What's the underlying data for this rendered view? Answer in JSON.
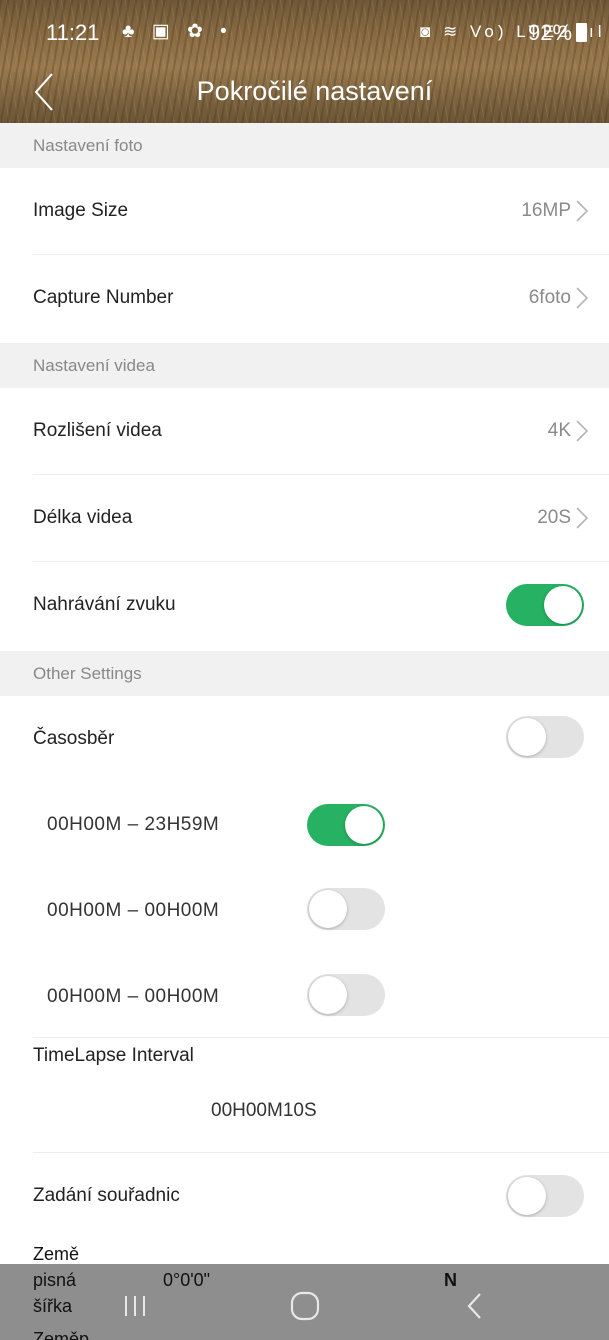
{
  "status_bar": {
    "time": "11:21",
    "left_icons": "♣ ▣ ✿ •",
    "right_icons": "◙ ≋ Vo) LTE2 .ıl",
    "battery": "92%"
  },
  "header": {
    "title": "Pokročilé nastavení"
  },
  "sections": {
    "photo": "Nastavení foto",
    "video": "Nastavení videa",
    "other": "Other Settings"
  },
  "photo": {
    "image_size_label": "Image Size",
    "image_size_value": "16MP",
    "capture_number_label": "Capture Number",
    "capture_number_value": "6foto"
  },
  "video": {
    "resolution_label": "Rozlišení videa",
    "resolution_value": "4K",
    "length_label": "Délka videa",
    "length_value": "20S",
    "audio_label": "Nahrávání zvuku",
    "audio_on": true
  },
  "other": {
    "timelapse_label": "Časosběr",
    "timelapse_on": false,
    "ranges": [
      {
        "text": "00H00M  –  23H59M",
        "on": true
      },
      {
        "text": "00H00M  –  00H00M",
        "on": false
      },
      {
        "text": "00H00M  –  00H00M",
        "on": false
      }
    ],
    "interval_label": "TimeLapse Interval",
    "interval_value": "00H00M10S",
    "coords_label": "Zadání souřadnic",
    "coords_on": false
  },
  "coords": {
    "zeme": "Země",
    "pisna": "pisná",
    "sirka": "šířka",
    "lat_value": "0°0'0\"",
    "lat_dir": "N",
    "cut_label": "Zeměp"
  },
  "colors": {
    "toggle_on": "#26b163",
    "toggle_off": "#e3e3e3",
    "section_bg": "#f1f1f1"
  }
}
